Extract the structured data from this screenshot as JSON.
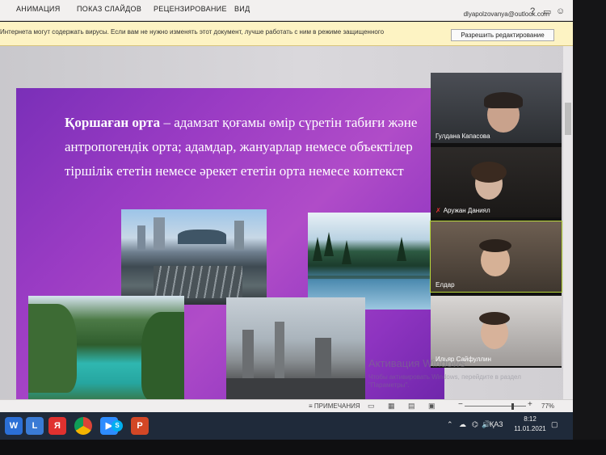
{
  "ribbon": {
    "tabs": [
      "АНИМАЦИЯ",
      "ПОКАЗ СЛАЙДОВ",
      "РЕЦЕНЗИРОВАНИЕ",
      "ВИД"
    ],
    "account": "dlyapolzovanya@outlook.com"
  },
  "warning_bar": {
    "text": "Интернета могут содержать вирусы. Если вам не нужно изменять этот документ, лучше работать с ним в режиме защищенного",
    "button_label": "Разрешить редактирование",
    "close": "×"
  },
  "slide": {
    "term": "Қоршаған орта",
    "definition": " – адамзат қоғамы өмір сүретін табиғи және антропогендік орта; адамдар, жануарлар немесе объектілер тіршілік ететін немесе әрекет ететін орта немесе контекст"
  },
  "participants": [
    {
      "name": "Гулдана Капасова",
      "muted": false
    },
    {
      "name": "Аружан Даниял",
      "muted": true
    },
    {
      "name": "Елдар",
      "muted": false
    },
    {
      "name": "Ильяр Сайфуллин",
      "muted": false
    }
  ],
  "watermark": {
    "title": "Активация Windows",
    "subtitle": "Чтобы активировать Windows, перейдите в раздел \"Параметры\"."
  },
  "status_bar": {
    "notes_label": "ПРИМЕЧАНИЯ",
    "zoom_minus": "−",
    "zoom_plus": "+",
    "zoom": "77%",
    "zoom_level": 0.77
  },
  "taskbar": {
    "yandex_glyph": "Я",
    "skype_glyph": "S",
    "powerpoint_glyph": "P",
    "keyboard_layout": "ҚАЗ",
    "time": "8:12",
    "date": "11.01.2021"
  },
  "colors": {
    "slide_purple": "#9b3cc4",
    "warning_yellow": "#fdf3c3",
    "active_tile_border": "#b8d93b",
    "taskbar": "#1f2a3a"
  }
}
